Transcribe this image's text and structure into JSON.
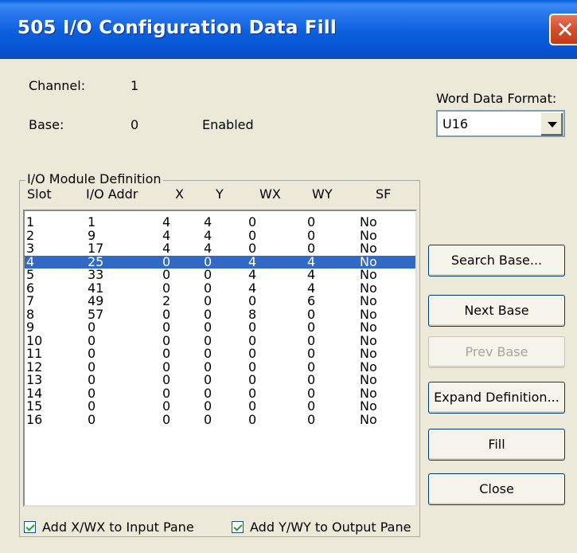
{
  "window": {
    "title": "505 I/O Configuration Data Fill",
    "close_glyph": "✕"
  },
  "info": {
    "channel_label": "Channel:",
    "channel_value": "1",
    "base_label": "Base:",
    "base_value": "0",
    "base_status": "Enabled"
  },
  "word_data_format": {
    "label": "Word Data Format:",
    "selected": "U16"
  },
  "io_module_definition": {
    "group_title": "I/O Module Definition",
    "columns": [
      "Slot",
      "I/O Addr",
      "X",
      "Y",
      "WX",
      "WY",
      "SF"
    ],
    "selected_row_index": 3,
    "rows": [
      [
        "1",
        "1",
        "4",
        "4",
        "0",
        "0",
        "No"
      ],
      [
        "2",
        "9",
        "4",
        "4",
        "0",
        "0",
        "No"
      ],
      [
        "3",
        "17",
        "4",
        "4",
        "0",
        "0",
        "No"
      ],
      [
        "4",
        "25",
        "0",
        "0",
        "4",
        "4",
        "No"
      ],
      [
        "5",
        "33",
        "0",
        "0",
        "4",
        "4",
        "No"
      ],
      [
        "6",
        "41",
        "0",
        "0",
        "4",
        "4",
        "No"
      ],
      [
        "7",
        "49",
        "2",
        "0",
        "0",
        "6",
        "No"
      ],
      [
        "8",
        "57",
        "0",
        "0",
        "8",
        "0",
        "No"
      ],
      [
        "9",
        "0",
        "0",
        "0",
        "0",
        "0",
        "No"
      ],
      [
        "10",
        "0",
        "0",
        "0",
        "0",
        "0",
        "No"
      ],
      [
        "11",
        "0",
        "0",
        "0",
        "0",
        "0",
        "No"
      ],
      [
        "12",
        "0",
        "0",
        "0",
        "0",
        "0",
        "No"
      ],
      [
        "13",
        "0",
        "0",
        "0",
        "0",
        "0",
        "No"
      ],
      [
        "14",
        "0",
        "0",
        "0",
        "0",
        "0",
        "No"
      ],
      [
        "15",
        "0",
        "0",
        "0",
        "0",
        "0",
        "No"
      ],
      [
        "16",
        "0",
        "0",
        "0",
        "0",
        "0",
        "No"
      ]
    ]
  },
  "buttons": {
    "search_base": "Search Base...",
    "next_base": "Next Base",
    "prev_base": "Prev Base",
    "expand_definition": "Expand Definition...",
    "fill": "Fill",
    "close": "Close"
  },
  "checkboxes": {
    "add_x_wx": {
      "label": "Add X/WX to Input Pane",
      "checked": true
    },
    "add_y_wy": {
      "label": "Add Y/WY to Output Pane",
      "checked": true
    }
  },
  "colors": {
    "title_bar": "#0a5fd8",
    "selection": "#316ac5",
    "dialog_background": "#ece9d8",
    "close_button": "#d5502f"
  }
}
